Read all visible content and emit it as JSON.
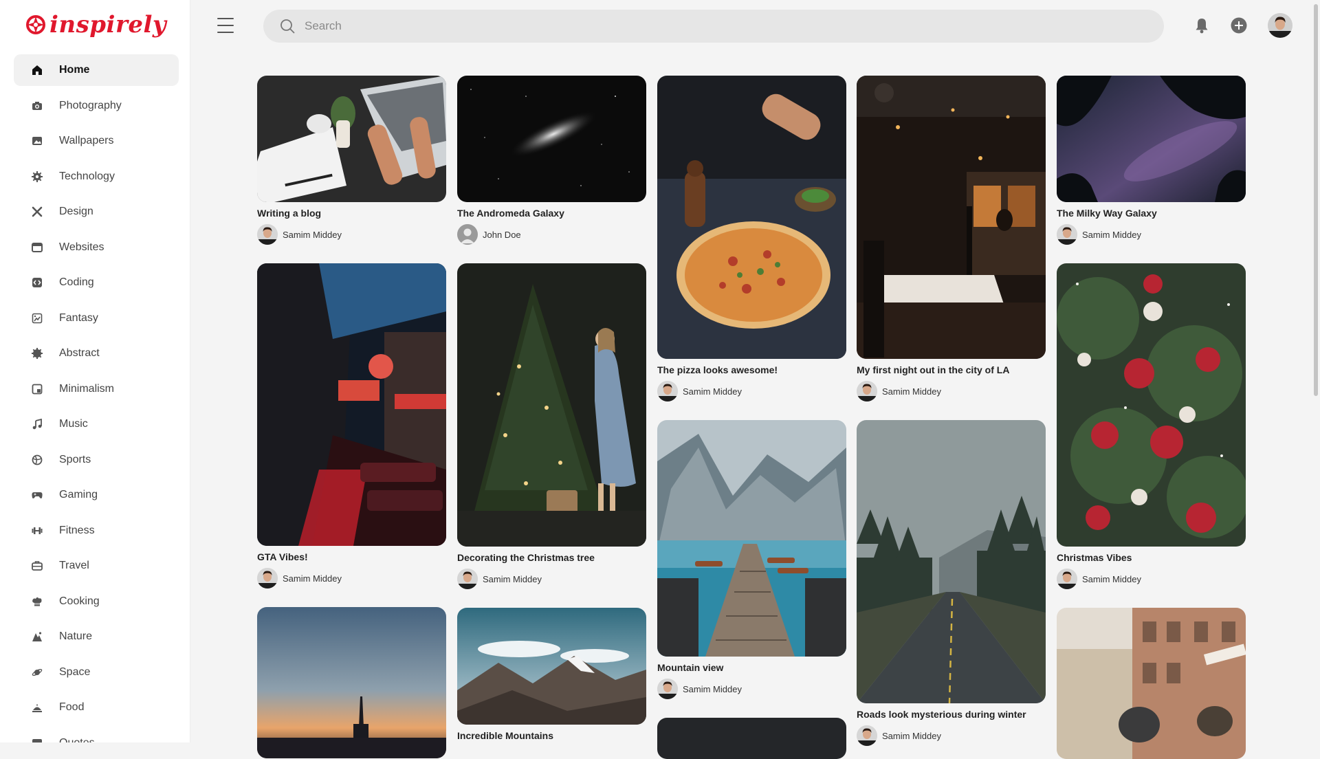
{
  "app": {
    "logo_text": "inspirely"
  },
  "search": {
    "placeholder": "Search"
  },
  "sidebar": {
    "items": [
      {
        "label": "Home",
        "icon": "home-icon",
        "active": true
      },
      {
        "label": "Photography",
        "icon": "camera-icon"
      },
      {
        "label": "Wallpapers",
        "icon": "image-icon"
      },
      {
        "label": "Technology",
        "icon": "gear-icon"
      },
      {
        "label": "Design",
        "icon": "design-tools-icon"
      },
      {
        "label": "Websites",
        "icon": "browser-window-icon"
      },
      {
        "label": "Coding",
        "icon": "code-icon"
      },
      {
        "label": "Fantasy",
        "icon": "fantasy-icon"
      },
      {
        "label": "Abstract",
        "icon": "abstract-icon"
      },
      {
        "label": "Minimalism",
        "icon": "minimal-square-icon"
      },
      {
        "label": "Music",
        "icon": "music-note-icon"
      },
      {
        "label": "Sports",
        "icon": "ball-icon"
      },
      {
        "label": "Gaming",
        "icon": "gamepad-icon"
      },
      {
        "label": "Fitness",
        "icon": "dumbbell-icon"
      },
      {
        "label": "Travel",
        "icon": "suitcase-icon"
      },
      {
        "label": "Cooking",
        "icon": "chef-hat-icon"
      },
      {
        "label": "Nature",
        "icon": "mountain-icon"
      },
      {
        "label": "Space",
        "icon": "planet-icon"
      },
      {
        "label": "Food",
        "icon": "food-icon"
      },
      {
        "label": "Quotes",
        "icon": "quote-icon"
      }
    ]
  },
  "pins": [
    {
      "title": "Writing a blog",
      "author": "Samim Middey"
    },
    {
      "title": "The Andromeda Galaxy",
      "author": "John Doe"
    },
    {
      "title": "The pizza looks awesome!",
      "author": "Samim Middey"
    },
    {
      "title": "My first night out in the city of LA",
      "author": "Samim Middey"
    },
    {
      "title": "The Milky Way Galaxy",
      "author": "Samim Middey"
    },
    {
      "title": "GTA Vibes!",
      "author": "Samim Middey"
    },
    {
      "title": "Decorating the Christmas tree",
      "author": "Samim Middey"
    },
    {
      "title": "Mountain view",
      "author": "Samim Middey"
    },
    {
      "title": "Roads look mysterious during winter",
      "author": "Samim Middey"
    },
    {
      "title": "Christmas Vibes",
      "author": "Samim Middey"
    },
    {
      "title": "",
      "author": ""
    },
    {
      "title": "Incredible Mountains",
      "author": ""
    },
    {
      "title": "",
      "author": ""
    },
    {
      "title": "",
      "author": ""
    }
  ]
}
